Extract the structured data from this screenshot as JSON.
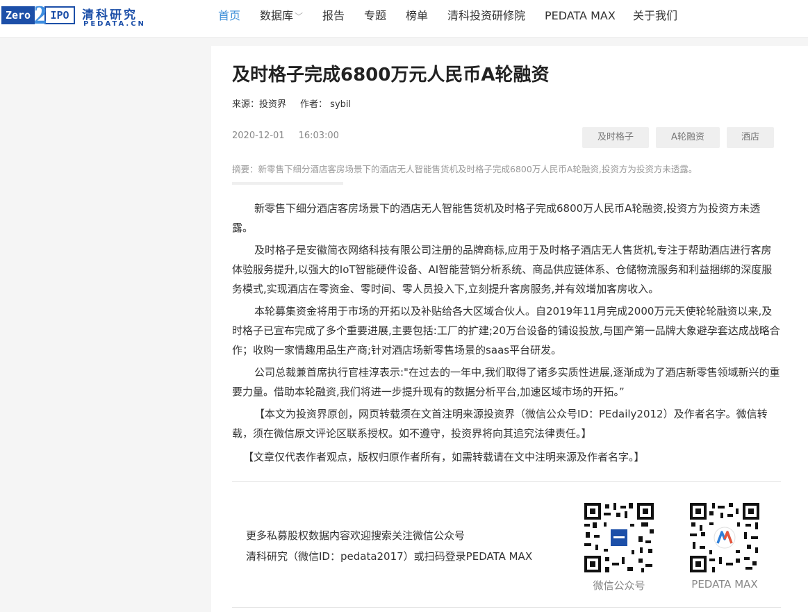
{
  "header": {
    "logo_left": "Zero",
    "logo_mid": "2",
    "logo_right": "IPO",
    "logo_cn": "清科研究",
    "logo_en": "PEDATA.CN",
    "nav": [
      {
        "label": "首页"
      },
      {
        "label": "数据库"
      },
      {
        "label": "报告"
      },
      {
        "label": "专题"
      },
      {
        "label": "榜单"
      },
      {
        "label": "清科投资研修院"
      },
      {
        "label": "PEDATA MAX"
      },
      {
        "label": "关于我们"
      }
    ],
    "active_color": "#3e8fd8"
  },
  "article": {
    "title": "及时格子完成6800万元人民币A轮融资",
    "source_label": "来源：投资界",
    "author_label": "作者：",
    "author": "sybil",
    "date": "2020-12-01",
    "time": "16:03:00",
    "tags": [
      "及时格子",
      "A轮融资",
      "酒店"
    ],
    "summary": "摘要：新零售下细分酒店客房场景下的酒店无人智能售货机及时格子完成6800万人民币A轮融资,投资方为投资方未透露。",
    "paragraphs": [
      "新零售下细分酒店客房场景下的酒店无人智能售货机及时格子完成6800万人民币A轮融资,投资方为投资方未透露。",
      "及时格子是安徽简衣网络科技有限公司注册的品牌商标,应用于及时格子酒店无人售货机,专注于帮助酒店进行客房体验服务提升,以强大的IoT智能硬件设备、AI智能营销分析系统、商品供应链体系、仓储物流服务和利益捆绑的深度服务模式,实现酒店在零资金、零时间、零人员投入下,立刻提升客房服务,并有效增加客房收入。",
      "本轮募集资金将用于市场的开拓以及补贴给各大区域合伙人。自2019年11月完成2000万元天使轮轮融资以来,及时格子已宣布完成了多个重要进展,主要包括:工厂的扩建;20万台设备的铺设投放,与国产第一品牌大象避孕套达成战略合作；收购一家情趣用品生产商;针对酒店场新零售场景的saas平台研发。",
      "公司总裁兼首席执行官桂淳表示:\"在过去的一年中,我们取得了诸多实质性进展,逐渐成为了酒店新零售领域新兴的重要力量。借助本轮融资,我们将进一步提升现有的数据分析平台,加速区域市场的开拓。”",
      "【本文为投资界原创，网页转载须在文首注明来源投资界（微信公众号ID：PEdaily2012）及作者名字。微信转载，须在微信原文评论区联系授权。如不遵守，投资界将向其追究法律责任。】",
      "【文章仅代表作者观点，版权归原作者所有，如需转载请在文中注明来源及作者名字。】"
    ]
  },
  "follow": {
    "line1": "更多私募股权数据内容欢迎搜索关注微信公众号",
    "line2": "清科研究（微信ID：pedata2017）或扫码登录PEDATA MAX",
    "qr_wechat_label": "微信公众号",
    "qr_max_label": "PEDATA MAX",
    "qr_wechat_icon": "qr-code-icon",
    "qr_max_icon": "qr-code-icon"
  }
}
